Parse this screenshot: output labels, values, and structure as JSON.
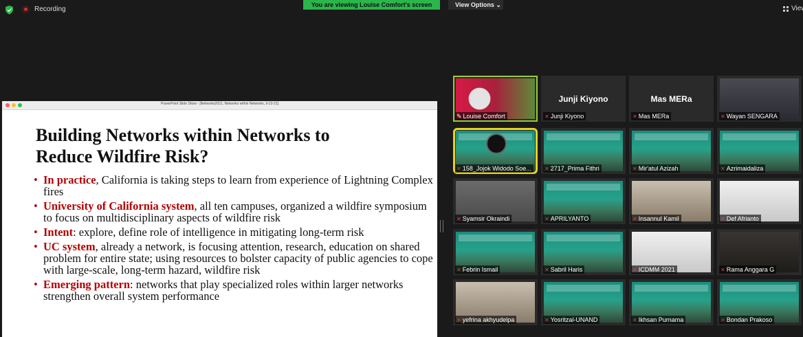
{
  "topbar": {
    "recording_label": "Recording",
    "banner_text": "You are viewing Louise Comfort's screen",
    "view_options_label": "View Options",
    "view_label": "View",
    "banner_color": "#2bb54b"
  },
  "slide_window": {
    "window_title": "PowerPoint Slide Show - [Networks2021, Networks within Networks, 9-22-21]",
    "slide": {
      "title_line1": "Building Networks within Networks to",
      "title_line2": "Reduce Wildfire Risk?",
      "bullets": [
        {
          "keyword": "In practice",
          "text": ", California is taking steps to learn from experience of Lightning Complex fires"
        },
        {
          "keyword": "University of California system",
          "text": ", all ten campuses, organized a wildfire symposium to focus on multidisciplinary aspects of wildfire risk"
        },
        {
          "keyword": "Intent",
          "text": ": explore, define role of intelligence in mitigating long-term risk"
        },
        {
          "keyword": "UC system",
          "text": ", already a network, is focusing attention, research, education on shared problem for entire state; using resources to bolster capacity of public agencies to cope with large-scale, long-term hazard, wildfire risk"
        },
        {
          "keyword": "Emerging pattern",
          "text": ": networks that play specialized roles within larger networks strengthen overall system performance"
        }
      ],
      "accent_color": "#b30000"
    }
  },
  "participants": [
    {
      "name": "Louise Comfort",
      "muted": false,
      "big_name": ""
    },
    {
      "name": "Junji Kiyono",
      "muted": true,
      "big_name": "Junji Kiyono"
    },
    {
      "name": "Mas MERa",
      "muted": true,
      "big_name": "Mas MERa"
    },
    {
      "name": "Wayan SENGARA",
      "muted": true,
      "big_name": ""
    },
    {
      "name": "158_Jojok Widodo Soe...",
      "muted": true,
      "big_name": ""
    },
    {
      "name": "2717_Prima Fithri",
      "muted": true,
      "big_name": ""
    },
    {
      "name": "Mir'atul Azizah",
      "muted": true,
      "big_name": ""
    },
    {
      "name": "Azrimaidaliza",
      "muted": true,
      "big_name": ""
    },
    {
      "name": "Syamsir Okraindi",
      "muted": true,
      "big_name": ""
    },
    {
      "name": "APRILYANTO",
      "muted": true,
      "big_name": ""
    },
    {
      "name": "Insannul Kamil",
      "muted": true,
      "big_name": ""
    },
    {
      "name": "Def Afrianto",
      "muted": true,
      "big_name": ""
    },
    {
      "name": "Febrin Ismail",
      "muted": true,
      "big_name": ""
    },
    {
      "name": "Sabril Haris",
      "muted": true,
      "big_name": ""
    },
    {
      "name": "ICDMM 2021",
      "muted": true,
      "big_name": ""
    },
    {
      "name": "Rama Anggara G",
      "muted": true,
      "big_name": ""
    },
    {
      "name": "yefrina akhyudelpa",
      "muted": true,
      "big_name": ""
    },
    {
      "name": "Yosritzal-UNAND",
      "muted": true,
      "big_name": ""
    },
    {
      "name": "Ikhsan Purnama",
      "muted": true,
      "big_name": ""
    },
    {
      "name": "Bondan Prakoso",
      "muted": true,
      "big_name": ""
    }
  ]
}
